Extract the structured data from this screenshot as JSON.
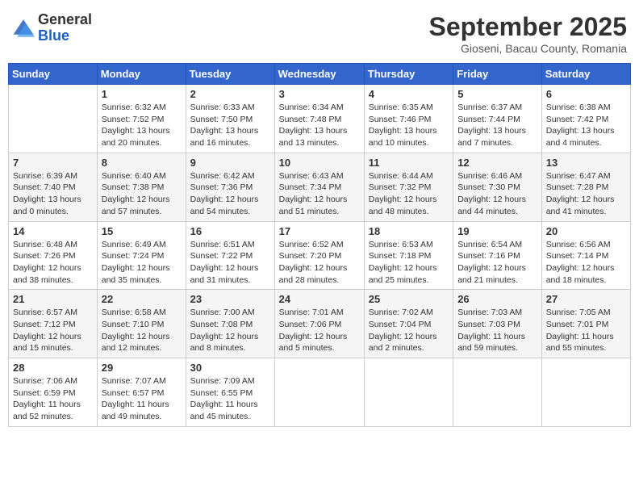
{
  "header": {
    "logo_line1": "General",
    "logo_line2": "Blue",
    "month": "September 2025",
    "location": "Gioseni, Bacau County, Romania"
  },
  "weekdays": [
    "Sunday",
    "Monday",
    "Tuesday",
    "Wednesday",
    "Thursday",
    "Friday",
    "Saturday"
  ],
  "weeks": [
    [
      {
        "day": "",
        "info": ""
      },
      {
        "day": "1",
        "info": "Sunrise: 6:32 AM\nSunset: 7:52 PM\nDaylight: 13 hours\nand 20 minutes."
      },
      {
        "day": "2",
        "info": "Sunrise: 6:33 AM\nSunset: 7:50 PM\nDaylight: 13 hours\nand 16 minutes."
      },
      {
        "day": "3",
        "info": "Sunrise: 6:34 AM\nSunset: 7:48 PM\nDaylight: 13 hours\nand 13 minutes."
      },
      {
        "day": "4",
        "info": "Sunrise: 6:35 AM\nSunset: 7:46 PM\nDaylight: 13 hours\nand 10 minutes."
      },
      {
        "day": "5",
        "info": "Sunrise: 6:37 AM\nSunset: 7:44 PM\nDaylight: 13 hours\nand 7 minutes."
      },
      {
        "day": "6",
        "info": "Sunrise: 6:38 AM\nSunset: 7:42 PM\nDaylight: 13 hours\nand 4 minutes."
      }
    ],
    [
      {
        "day": "7",
        "info": "Sunrise: 6:39 AM\nSunset: 7:40 PM\nDaylight: 13 hours\nand 0 minutes."
      },
      {
        "day": "8",
        "info": "Sunrise: 6:40 AM\nSunset: 7:38 PM\nDaylight: 12 hours\nand 57 minutes."
      },
      {
        "day": "9",
        "info": "Sunrise: 6:42 AM\nSunset: 7:36 PM\nDaylight: 12 hours\nand 54 minutes."
      },
      {
        "day": "10",
        "info": "Sunrise: 6:43 AM\nSunset: 7:34 PM\nDaylight: 12 hours\nand 51 minutes."
      },
      {
        "day": "11",
        "info": "Sunrise: 6:44 AM\nSunset: 7:32 PM\nDaylight: 12 hours\nand 48 minutes."
      },
      {
        "day": "12",
        "info": "Sunrise: 6:46 AM\nSunset: 7:30 PM\nDaylight: 12 hours\nand 44 minutes."
      },
      {
        "day": "13",
        "info": "Sunrise: 6:47 AM\nSunset: 7:28 PM\nDaylight: 12 hours\nand 41 minutes."
      }
    ],
    [
      {
        "day": "14",
        "info": "Sunrise: 6:48 AM\nSunset: 7:26 PM\nDaylight: 12 hours\nand 38 minutes."
      },
      {
        "day": "15",
        "info": "Sunrise: 6:49 AM\nSunset: 7:24 PM\nDaylight: 12 hours\nand 35 minutes."
      },
      {
        "day": "16",
        "info": "Sunrise: 6:51 AM\nSunset: 7:22 PM\nDaylight: 12 hours\nand 31 minutes."
      },
      {
        "day": "17",
        "info": "Sunrise: 6:52 AM\nSunset: 7:20 PM\nDaylight: 12 hours\nand 28 minutes."
      },
      {
        "day": "18",
        "info": "Sunrise: 6:53 AM\nSunset: 7:18 PM\nDaylight: 12 hours\nand 25 minutes."
      },
      {
        "day": "19",
        "info": "Sunrise: 6:54 AM\nSunset: 7:16 PM\nDaylight: 12 hours\nand 21 minutes."
      },
      {
        "day": "20",
        "info": "Sunrise: 6:56 AM\nSunset: 7:14 PM\nDaylight: 12 hours\nand 18 minutes."
      }
    ],
    [
      {
        "day": "21",
        "info": "Sunrise: 6:57 AM\nSunset: 7:12 PM\nDaylight: 12 hours\nand 15 minutes."
      },
      {
        "day": "22",
        "info": "Sunrise: 6:58 AM\nSunset: 7:10 PM\nDaylight: 12 hours\nand 12 minutes."
      },
      {
        "day": "23",
        "info": "Sunrise: 7:00 AM\nSunset: 7:08 PM\nDaylight: 12 hours\nand 8 minutes."
      },
      {
        "day": "24",
        "info": "Sunrise: 7:01 AM\nSunset: 7:06 PM\nDaylight: 12 hours\nand 5 minutes."
      },
      {
        "day": "25",
        "info": "Sunrise: 7:02 AM\nSunset: 7:04 PM\nDaylight: 12 hours\nand 2 minutes."
      },
      {
        "day": "26",
        "info": "Sunrise: 7:03 AM\nSunset: 7:03 PM\nDaylight: 11 hours\nand 59 minutes."
      },
      {
        "day": "27",
        "info": "Sunrise: 7:05 AM\nSunset: 7:01 PM\nDaylight: 11 hours\nand 55 minutes."
      }
    ],
    [
      {
        "day": "28",
        "info": "Sunrise: 7:06 AM\nSunset: 6:59 PM\nDaylight: 11 hours\nand 52 minutes."
      },
      {
        "day": "29",
        "info": "Sunrise: 7:07 AM\nSunset: 6:57 PM\nDaylight: 11 hours\nand 49 minutes."
      },
      {
        "day": "30",
        "info": "Sunrise: 7:09 AM\nSunset: 6:55 PM\nDaylight: 11 hours\nand 45 minutes."
      },
      {
        "day": "",
        "info": ""
      },
      {
        "day": "",
        "info": ""
      },
      {
        "day": "",
        "info": ""
      },
      {
        "day": "",
        "info": ""
      }
    ]
  ]
}
